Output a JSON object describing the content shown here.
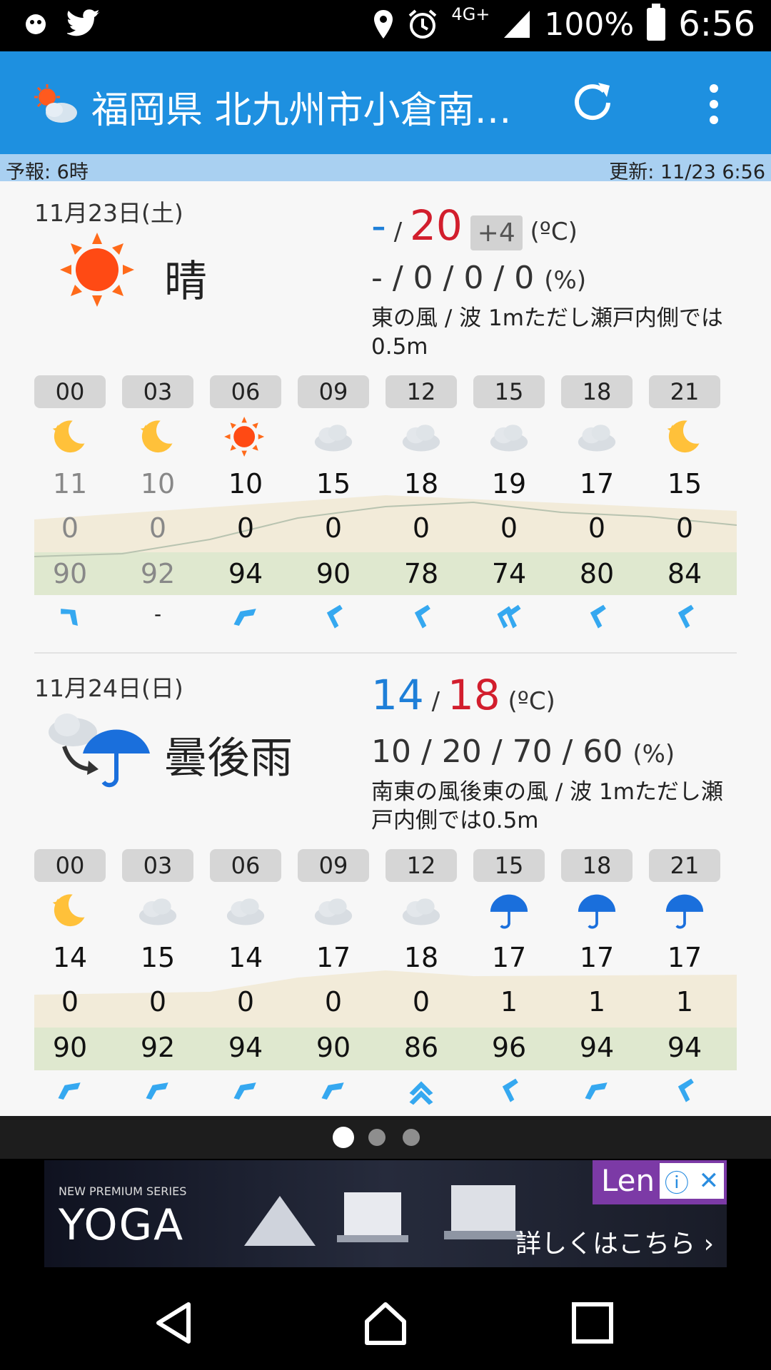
{
  "status_bar": {
    "network": "4G+",
    "battery": "100%",
    "time": "6:56"
  },
  "app_bar": {
    "title": "福岡県 北九州市小倉南…"
  },
  "info_bar": {
    "forecast_label": "予報: 6時",
    "updated_label": "更新: 11/23 6:56"
  },
  "days": [
    {
      "date": "11月23日(土)",
      "weather_text": "晴",
      "weather_icon": "sun",
      "temp_min": "-",
      "temp_sep": "/",
      "temp_max": "20",
      "temp_diff": "+4",
      "temp_unit": "(ºC)",
      "rain_values": "- / 0 / 0 / 0",
      "rain_unit": "(%)",
      "wind": "東の風 / 波 1mただし瀬戸内側では0.5m",
      "hours": [
        "00",
        "03",
        "06",
        "09",
        "12",
        "15",
        "18",
        "21"
      ],
      "icons": [
        "moon",
        "moon",
        "sun",
        "cloud",
        "cloud",
        "cloud",
        "cloud",
        "moon"
      ],
      "temps": [
        "11",
        "10",
        "10",
        "15",
        "18",
        "19",
        "17",
        "15"
      ],
      "precip": [
        "0",
        "0",
        "0",
        "0",
        "0",
        "0",
        "0",
        "0"
      ],
      "humidity": [
        "90",
        "92",
        "94",
        "90",
        "78",
        "74",
        "80",
        "84"
      ],
      "winds": [
        "down-right",
        "-",
        "up-right",
        "left",
        "left",
        "left-double",
        "left",
        "left"
      ],
      "past_count": 2
    },
    {
      "date": "11月24日(日)",
      "weather_text": "曇後雨",
      "weather_icon": "cloud-then-umbrella",
      "temp_min": "14",
      "temp_sep": "/",
      "temp_max": "18",
      "temp_unit": "(ºC)",
      "rain_values": "10 / 20 / 70 / 60",
      "rain_unit": "(%)",
      "wind": "南東の風後東の風 / 波 1mただし瀬戸内側では0.5m",
      "hours": [
        "00",
        "03",
        "06",
        "09",
        "12",
        "15",
        "18",
        "21"
      ],
      "icons": [
        "moon",
        "cloud",
        "cloud",
        "cloud",
        "cloud",
        "umbrella",
        "umbrella",
        "umbrella"
      ],
      "temps": [
        "14",
        "15",
        "14",
        "17",
        "18",
        "17",
        "17",
        "17"
      ],
      "precip": [
        "0",
        "0",
        "0",
        "0",
        "0",
        "1",
        "1",
        "1"
      ],
      "humidity": [
        "90",
        "92",
        "94",
        "90",
        "86",
        "96",
        "94",
        "94"
      ],
      "winds": [
        "up-right",
        "up-right",
        "up-right",
        "up-right",
        "up-double",
        "left",
        "up-right",
        "left"
      ],
      "past_count": 0
    }
  ],
  "ad": {
    "series": "NEW PREMIUM SERIES",
    "brand_name": "YOGA",
    "sponsor": "Len",
    "cta": "詳しくはこちら ›"
  },
  "pager": {
    "pages": 3,
    "active": 0
  },
  "colors": {
    "app_bar": "#1e90e0",
    "temp_min": "#1e7fd8",
    "temp_max": "#d21e2d",
    "info_bar": "#a9d0f1"
  }
}
